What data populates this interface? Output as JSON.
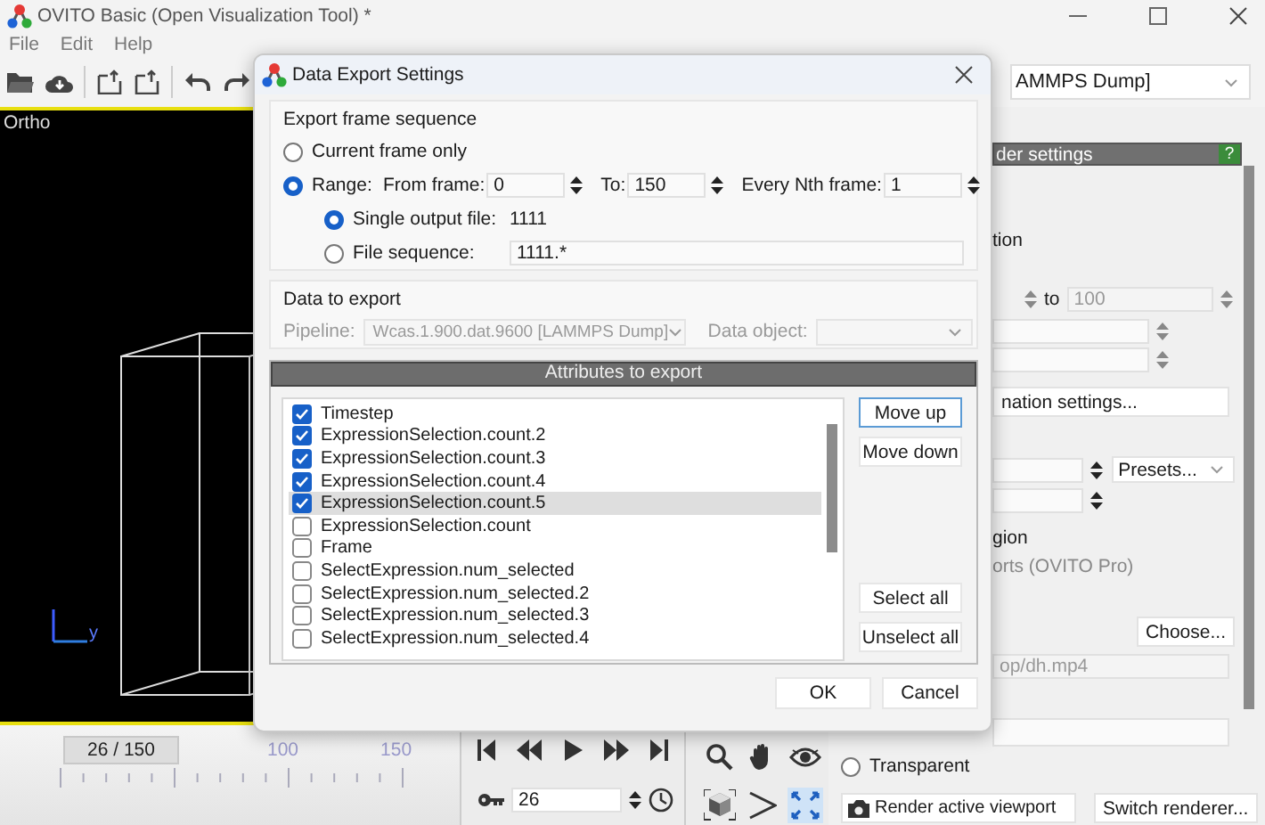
{
  "window": {
    "title": "OVITO Basic (Open Visualization Tool) *"
  },
  "menu": [
    "File",
    "Edit",
    "Help"
  ],
  "pipeline_selector": {
    "value": "AMMPS Dump]"
  },
  "viewport": {
    "label": "Ortho",
    "axis_label": "y"
  },
  "render_panel": {
    "title": "der settings",
    "help": "?",
    "range_label": "tion",
    "to_label": "to",
    "to_value": "100",
    "animation_button": "nation settings...",
    "presets": "Presets...",
    "region_label": "gion",
    "viewports_note": "orts (OVITO Pro)",
    "choose_button": "Choose...",
    "output_path": "op/dh.mp4",
    "transparent": {
      "label": "Transparent",
      "checked": false
    },
    "render_button": "Render active viewport",
    "switch_button": "Switch renderer..."
  },
  "timeline": {
    "thumb": "26 / 150",
    "level": 0.17,
    "labels": [
      "100",
      "150"
    ]
  },
  "animation": {
    "frame": "26"
  },
  "dialog": {
    "title": "Data Export Settings",
    "frame_sequence": {
      "title": "Export frame sequence",
      "options": [
        {
          "label": "Current frame only",
          "selected": false
        },
        {
          "label": "Range:",
          "selected": true
        }
      ],
      "from_label": "From frame:",
      "from": "0",
      "to_label": "To:",
      "to": "150",
      "nth_label": "Every Nth frame:",
      "nth": "1",
      "outputs": [
        {
          "kind": "text",
          "label": "Single output file:",
          "value": "1111",
          "selected": true
        },
        {
          "kind": "field",
          "label": "File sequence:",
          "value": "1111.*",
          "selected": false
        }
      ]
    },
    "data": {
      "title": "Data to export",
      "pipeline_label": "Pipeline:",
      "pipeline": "Wcas.1.900.dat.9600 [LAMMPS Dump]",
      "object_label": "Data object:",
      "disabled": true
    },
    "attributes": {
      "title": "Attributes to export",
      "items": [
        {
          "label": "Timestep",
          "checked": true,
          "selected": false
        },
        {
          "label": "ExpressionSelection.count.2",
          "checked": true,
          "selected": false
        },
        {
          "label": "ExpressionSelection.count.3",
          "checked": true,
          "selected": false
        },
        {
          "label": "ExpressionSelection.count.4",
          "checked": true,
          "selected": false
        },
        {
          "label": "ExpressionSelection.count.5",
          "checked": true,
          "selected": true
        },
        {
          "label": "ExpressionSelection.count",
          "checked": false,
          "selected": false
        },
        {
          "label": "Frame",
          "checked": false,
          "selected": false
        },
        {
          "label": "SelectExpression.num_selected",
          "checked": false,
          "selected": false
        },
        {
          "label": "SelectExpression.num_selected.2",
          "checked": false,
          "selected": false
        },
        {
          "label": "SelectExpression.num_selected.3",
          "checked": false,
          "selected": false
        },
        {
          "label": "SelectExpression.num_selected.4",
          "checked": false,
          "selected": false
        }
      ],
      "buttons": [
        {
          "label": "Move up",
          "focused": true
        },
        {
          "label": "Move down",
          "focused": false
        },
        {
          "label": "Select all",
          "focused": false
        },
        {
          "label": "Unselect all",
          "focused": false
        }
      ]
    },
    "buttons": [
      "OK",
      "Cancel"
    ]
  }
}
